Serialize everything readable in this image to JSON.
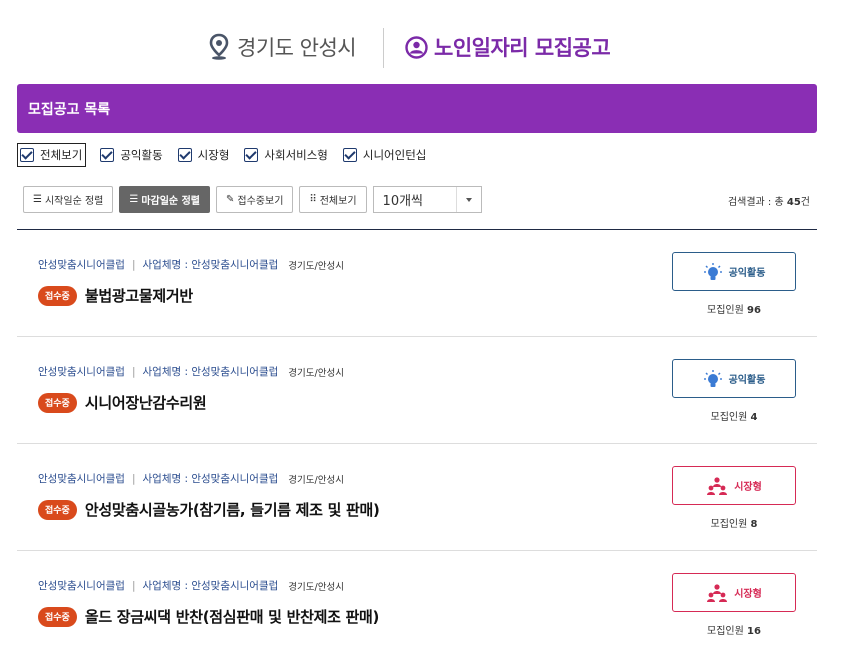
{
  "header": {
    "location": "경기도 안성시",
    "title": "노인일자리 모집공고"
  },
  "banner": {
    "title": "모집공고 목록"
  },
  "filters": [
    {
      "label": "전체보기",
      "checked": true
    },
    {
      "label": "공익활동",
      "checked": true
    },
    {
      "label": "시장형",
      "checked": true
    },
    {
      "label": "사회서비스형",
      "checked": true
    },
    {
      "label": "시니어인턴십",
      "checked": true
    }
  ],
  "toolbar": {
    "sort_start": "시작일순 정렬",
    "sort_deadline": "마감일순 정렬",
    "receiving": "접수중보기",
    "view_all": "전체보기",
    "page_size": "10개씩",
    "result_prefix": "검색결과 : 총",
    "result_count": "45",
    "result_suffix": "건"
  },
  "recruit_label": "모집인원",
  "items": [
    {
      "org": "안성맞춤시니어클럽",
      "sep": "|",
      "biz": "사업체명 : 안성맞춤시니어클럽",
      "region": "경기도/안성시",
      "status": "접수중",
      "title": "불법광고물제거반",
      "type": "공익활동",
      "type_icon": "lightbulb-icon",
      "count": "96"
    },
    {
      "org": "안성맞춤시니어클럽",
      "sep": "|",
      "biz": "사업체명 : 안성맞춤시니어클럽",
      "region": "경기도/안성시",
      "status": "접수중",
      "title": "시니어장난감수리원",
      "type": "공익활동",
      "type_icon": "lightbulb-icon",
      "count": "4"
    },
    {
      "org": "안성맞춤시니어클럽",
      "sep": "|",
      "biz": "사업체명 : 안성맞춤시니어클럽",
      "region": "경기도/안성시",
      "status": "접수중",
      "title": "안성맞춤시골농가(참기름, 들기름 제조 및 판매)",
      "type": "시장형",
      "type_icon": "people-group-icon",
      "count": "8"
    },
    {
      "org": "안성맞춤시니어클럽",
      "sep": "|",
      "biz": "사업체명 : 안성맞춤시니어클럽",
      "region": "경기도/안성시",
      "status": "접수중",
      "title": "올드 장금씨댁 반찬(점심판매 및 반찬제조 판매)",
      "type": "시장형",
      "type_icon": "people-group-icon",
      "count": "16"
    }
  ],
  "colors": {
    "accent": "#8a2eb4",
    "public": "#2b5d8a",
    "market": "#d62a55",
    "badge": "#d94a1c"
  }
}
